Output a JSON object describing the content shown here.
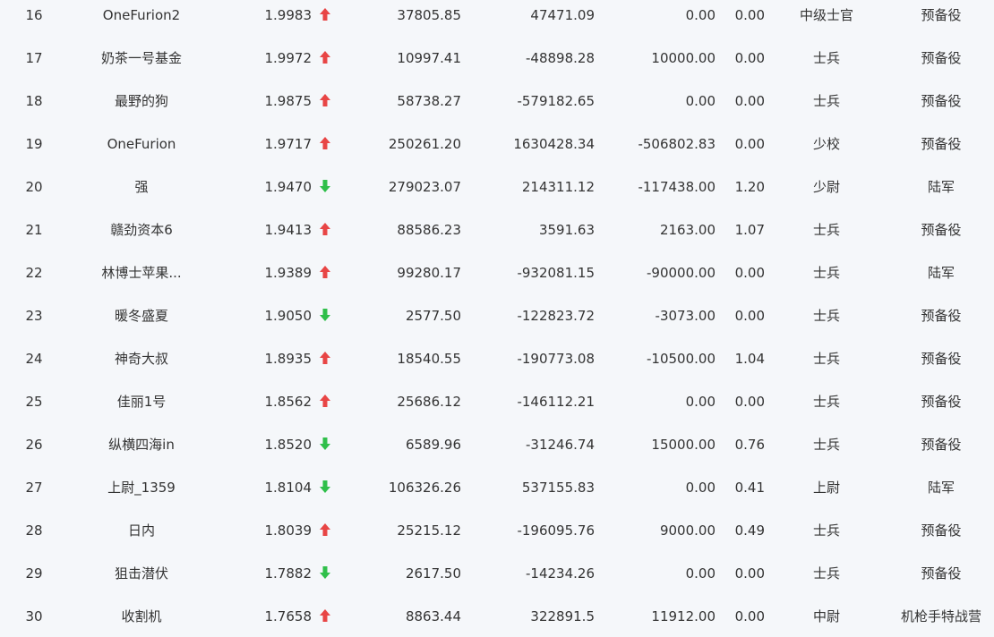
{
  "colors": {
    "up": "#e84545",
    "down": "#2fbf4a",
    "text": "#333333",
    "background": "#f5f7fa"
  },
  "table": {
    "rows": [
      {
        "rank": "16",
        "name": "OneFurion2",
        "score": "1.9983",
        "trend": "up",
        "v1": "37805.85",
        "v2": "47471.09",
        "v3": "0.00",
        "v4": "0.00",
        "rank_name": "中级士官",
        "unit": "预备役"
      },
      {
        "rank": "17",
        "name": "奶茶一号基金",
        "score": "1.9972",
        "trend": "up",
        "v1": "10997.41",
        "v2": "-48898.28",
        "v3": "10000.00",
        "v4": "0.00",
        "rank_name": "士兵",
        "unit": "预备役"
      },
      {
        "rank": "18",
        "name": "最野的狗",
        "score": "1.9875",
        "trend": "up",
        "v1": "58738.27",
        "v2": "-579182.65",
        "v3": "0.00",
        "v4": "0.00",
        "rank_name": "士兵",
        "unit": "预备役"
      },
      {
        "rank": "19",
        "name": "OneFurion",
        "score": "1.9717",
        "trend": "up",
        "v1": "250261.20",
        "v2": "1630428.34",
        "v3": "-506802.83",
        "v4": "0.00",
        "rank_name": "少校",
        "unit": "预备役"
      },
      {
        "rank": "20",
        "name": "强",
        "score": "1.9470",
        "trend": "down",
        "v1": "279023.07",
        "v2": "214311.12",
        "v3": "-117438.00",
        "v4": "1.20",
        "rank_name": "少尉",
        "unit": "陆军"
      },
      {
        "rank": "21",
        "name": "赣劲资本6",
        "score": "1.9413",
        "trend": "up",
        "v1": "88586.23",
        "v2": "3591.63",
        "v3": "2163.00",
        "v4": "1.07",
        "rank_name": "士兵",
        "unit": "预备役"
      },
      {
        "rank": "22",
        "name": "林博士苹果...",
        "score": "1.9389",
        "trend": "up",
        "v1": "99280.17",
        "v2": "-932081.15",
        "v3": "-90000.00",
        "v4": "0.00",
        "rank_name": "士兵",
        "unit": "陆军"
      },
      {
        "rank": "23",
        "name": "暖冬盛夏",
        "score": "1.9050",
        "trend": "down",
        "v1": "2577.50",
        "v2": "-122823.72",
        "v3": "-3073.00",
        "v4": "0.00",
        "rank_name": "士兵",
        "unit": "预备役"
      },
      {
        "rank": "24",
        "name": "神奇大叔",
        "score": "1.8935",
        "trend": "up",
        "v1": "18540.55",
        "v2": "-190773.08",
        "v3": "-10500.00",
        "v4": "1.04",
        "rank_name": "士兵",
        "unit": "预备役"
      },
      {
        "rank": "25",
        "name": "佳丽1号",
        "score": "1.8562",
        "trend": "up",
        "v1": "25686.12",
        "v2": "-146112.21",
        "v3": "0.00",
        "v4": "0.00",
        "rank_name": "士兵",
        "unit": "预备役"
      },
      {
        "rank": "26",
        "name": "纵横四海in",
        "score": "1.8520",
        "trend": "down",
        "v1": "6589.96",
        "v2": "-31246.74",
        "v3": "15000.00",
        "v4": "0.76",
        "rank_name": "士兵",
        "unit": "预备役"
      },
      {
        "rank": "27",
        "name": "上尉_1359",
        "score": "1.8104",
        "trend": "down",
        "v1": "106326.26",
        "v2": "537155.83",
        "v3": "0.00",
        "v4": "0.41",
        "rank_name": "上尉",
        "unit": "陆军"
      },
      {
        "rank": "28",
        "name": "日内",
        "score": "1.8039",
        "trend": "up",
        "v1": "25215.12",
        "v2": "-196095.76",
        "v3": "9000.00",
        "v4": "0.49",
        "rank_name": "士兵",
        "unit": "预备役"
      },
      {
        "rank": "29",
        "name": "狙击潜伏",
        "score": "1.7882",
        "trend": "down",
        "v1": "2617.50",
        "v2": "-14234.26",
        "v3": "0.00",
        "v4": "0.00",
        "rank_name": "士兵",
        "unit": "预备役"
      },
      {
        "rank": "30",
        "name": "收割机",
        "score": "1.7658",
        "trend": "up",
        "v1": "8863.44",
        "v2": "322891.5",
        "v3": "11912.00",
        "v4": "0.00",
        "rank_name": "中尉",
        "unit": "机枪手特战营"
      }
    ]
  }
}
